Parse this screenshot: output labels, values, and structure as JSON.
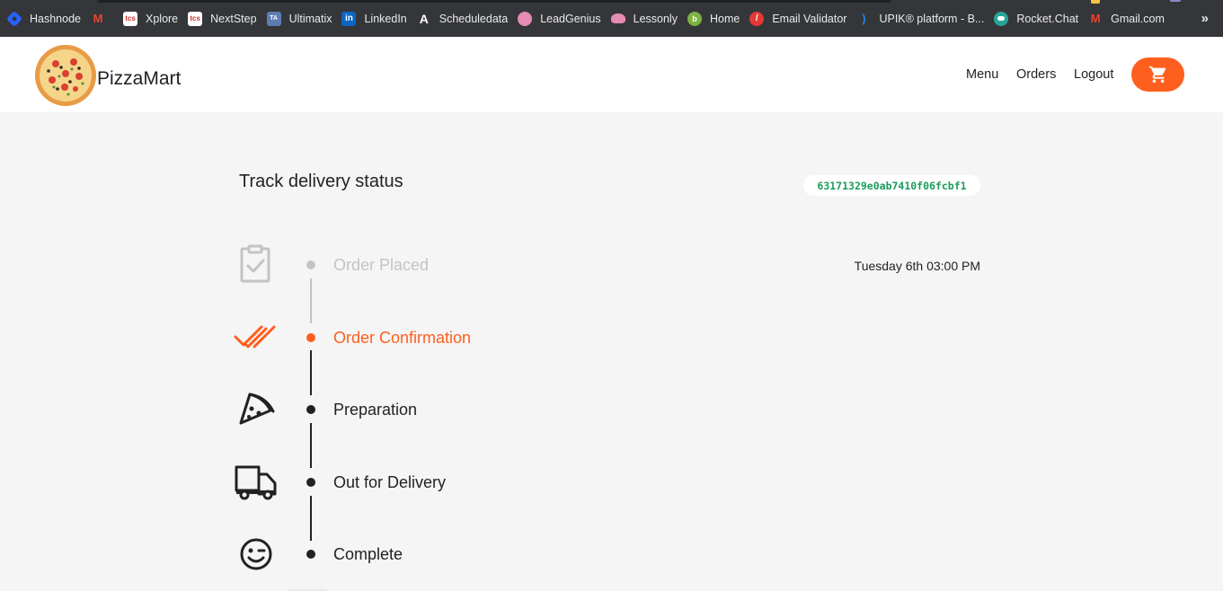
{
  "bookmarks": [
    {
      "label": "Hashnode",
      "icon": "hashnode-icon",
      "color": "#2962ff"
    },
    {
      "label": "",
      "icon": "gmail-icon",
      "color": "#ea4335"
    },
    {
      "label": "Xplore",
      "icon": "tcs-icon",
      "color": "#d32f2f"
    },
    {
      "label": "NextStep",
      "icon": "tcs-icon",
      "color": "#d32f2f"
    },
    {
      "label": "Ultimatix",
      "icon": "tata-icon",
      "color": "#5b7db1"
    },
    {
      "label": "LinkedIn",
      "icon": "linkedin-icon",
      "color": "#0a66c2"
    },
    {
      "label": "Scheduledata",
      "icon": "a-logo-icon",
      "color": "#111111"
    },
    {
      "label": "LeadGenius",
      "icon": "brain-icon",
      "color": "#e58bb4"
    },
    {
      "label": "Lessonly",
      "icon": "brain-icon",
      "color": "#e58bb4"
    },
    {
      "label": "Home",
      "icon": "home-icon",
      "color": "#7cb342"
    },
    {
      "label": "Email Validator",
      "icon": "validator-icon",
      "color": "#e53935"
    },
    {
      "label": "UPIK® platform - B...",
      "icon": "upik-icon",
      "color": "#1e88e5"
    },
    {
      "label": "Rocket.Chat",
      "icon": "rocketchat-icon",
      "color": "#26a69a"
    },
    {
      "label": "Gmail.com",
      "icon": "gmail-icon",
      "color": "#ea4335"
    }
  ],
  "bookmarks_more": "»",
  "header": {
    "brand": "PizzaMart",
    "nav": [
      "Menu",
      "Orders",
      "Logout"
    ],
    "cart_icon": "cart-icon",
    "accent": "#fe5f1e"
  },
  "tracker": {
    "title": "Track delivery status",
    "order_id": "63171329e0ab7410f06fcbf1",
    "steps": [
      {
        "label": "Order Placed",
        "icon": "clipboard-check-icon",
        "state": "done",
        "time": "Tuesday 6th 03:00 PM"
      },
      {
        "label": "Order Confirmation",
        "icon": "double-check-icon",
        "state": "current"
      },
      {
        "label": "Preparation",
        "icon": "pizza-slice-icon",
        "state": "pending"
      },
      {
        "label": "Out for Delivery",
        "icon": "truck-icon",
        "state": "pending"
      },
      {
        "label": "Complete",
        "icon": "wink-face-icon",
        "state": "pending"
      }
    ]
  }
}
